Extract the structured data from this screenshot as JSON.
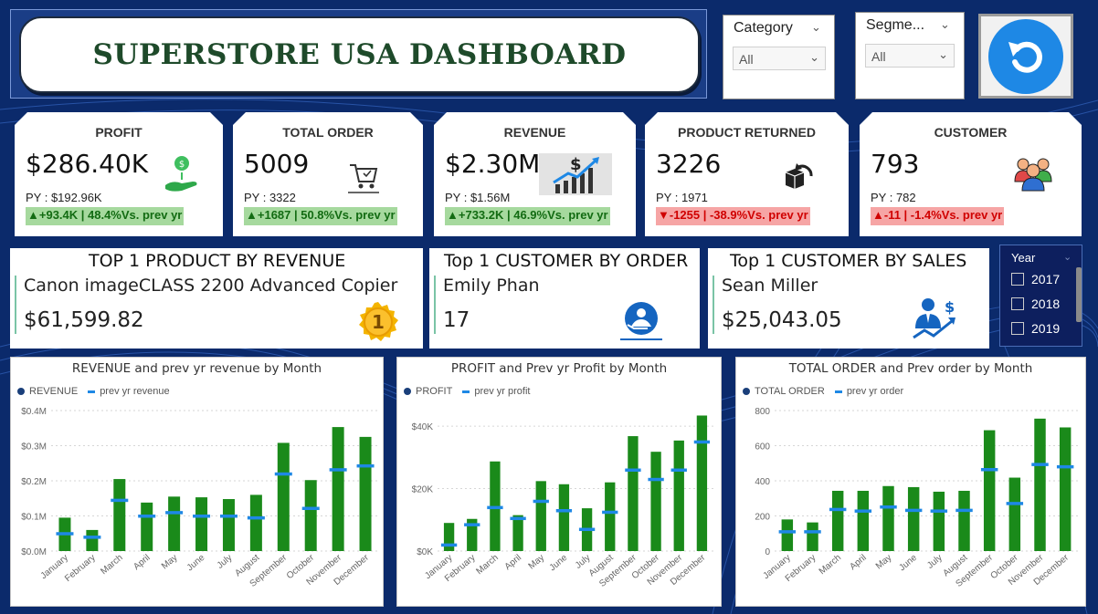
{
  "header": {
    "title": "SUPERSTORE USA DASHBOARD"
  },
  "filters": {
    "category": {
      "label": "Category",
      "value": "All"
    },
    "segment": {
      "label": "Segme...",
      "value": "All"
    },
    "reset_icon": "reset-arrow-icon"
  },
  "kpis": [
    {
      "title": "PROFIT",
      "value": "$286.40K",
      "py": "PY : $192.96K",
      "delta": "▲+93.4K | 48.4%Vs. prev yr",
      "trend": "up",
      "icon": "money-hand-icon"
    },
    {
      "title": "TOTAL ORDER",
      "value": "5009",
      "py": "PY :  3322",
      "delta": "▲+1687 | 50.8%Vs. prev yr",
      "trend": "up",
      "icon": "cart-icon"
    },
    {
      "title": "REVENUE",
      "value": "$2.30M",
      "py": "PY : $1.56M",
      "delta": "▲+733.2K | 46.9%Vs. prev yr",
      "trend": "up",
      "icon": "revenue-growth-icon"
    },
    {
      "title": "PRODUCT RETURNED",
      "value": "3226",
      "py": "PY :  1971",
      "delta": "▼-1255 | -38.9%Vs. prev yr",
      "trend": "down",
      "icon": "return-box-icon"
    },
    {
      "title": "CUSTOMER",
      "value": "793",
      "py": "PY : 782",
      "delta": "▲-11 | -1.4%Vs. prev yr",
      "trend": "down",
      "icon": "customers-icon"
    }
  ],
  "top_cards": [
    {
      "title": "TOP 1 PRODUCT BY REVENUE",
      "name": "Canon imageCLASS 2200 Advanced Copier",
      "value": "$61,599.82",
      "icon": "first-place-medal-icon"
    },
    {
      "title": "Top 1 CUSTOMER BY ORDER",
      "name": "Emily Phan",
      "value": "17",
      "icon": "customer-service-icon"
    },
    {
      "title": "Top 1 CUSTOMER BY SALES",
      "name": "Sean Miller",
      "value": "$25,043.05",
      "icon": "businessman-growth-icon"
    }
  ],
  "year_slicer": {
    "title": "Year",
    "options": [
      "2017",
      "2018",
      "2019"
    ]
  },
  "colors": {
    "bar": "#1a8a1a",
    "prev_marker": "#1e88e5",
    "legend_dot": "#1a3f7a",
    "background": "#0b2a6b"
  },
  "chart_data": [
    {
      "type": "bar",
      "title": "REVENUE and prev yr revenue by Month",
      "legend": [
        "REVENUE",
        "prev yr revenue"
      ],
      "categories": [
        "January",
        "February",
        "March",
        "April",
        "May",
        "June",
        "July",
        "August",
        "September",
        "October",
        "November",
        "December"
      ],
      "series": [
        {
          "name": "REVENUE",
          "values": [
            0.095,
            0.06,
            0.205,
            0.138,
            0.155,
            0.153,
            0.148,
            0.16,
            0.308,
            0.202,
            0.353,
            0.325
          ]
        },
        {
          "name": "prev yr revenue",
          "values": [
            0.05,
            0.04,
            0.145,
            0.1,
            0.11,
            0.1,
            0.1,
            0.095,
            0.22,
            0.122,
            0.232,
            0.243
          ]
        }
      ],
      "ylim": [
        0,
        0.4
      ],
      "yticks": [
        "$0.0M",
        "$0.1M",
        "$0.2M",
        "$0.3M",
        "$0.4M"
      ],
      "ytick_values": [
        0,
        0.1,
        0.2,
        0.3,
        0.4
      ],
      "grid": true
    },
    {
      "type": "bar",
      "title": "PROFIT and Prev yr Profit by Month",
      "legend": [
        "PROFIT",
        "prev yr profit"
      ],
      "categories": [
        "January",
        "February",
        "March",
        "April",
        "May",
        "June",
        "July",
        "August",
        "September",
        "October",
        "November",
        "December"
      ],
      "series": [
        {
          "name": "PROFIT",
          "values": [
            9000,
            10300,
            28700,
            11500,
            22400,
            21400,
            13700,
            22000,
            36800,
            31800,
            35400,
            43400
          ]
        },
        {
          "name": "prev yr profit",
          "values": [
            2000,
            8500,
            14000,
            10500,
            16000,
            13000,
            7000,
            12500,
            26000,
            23000,
            26000,
            35000
          ]
        }
      ],
      "ylim": [
        0,
        45000
      ],
      "yticks": [
        "$0K",
        "$20K",
        "$40K"
      ],
      "ytick_values": [
        0,
        20000,
        40000
      ],
      "grid": true
    },
    {
      "type": "bar",
      "title": "TOTAL ORDER and Prev order by Month",
      "legend": [
        "TOTAL ORDER",
        "prev yr order"
      ],
      "categories": [
        "January",
        "February",
        "March",
        "April",
        "May",
        "June",
        "July",
        "August",
        "September",
        "October",
        "November",
        "December"
      ],
      "series": [
        {
          "name": "TOTAL ORDER",
          "values": [
            180,
            163,
            343,
            343,
            370,
            364,
            338,
            343,
            688,
            418,
            754,
            704
          ]
        },
        {
          "name": "prev yr order",
          "values": [
            111,
            111,
            238,
            229,
            252,
            233,
            229,
            233,
            465,
            272,
            494,
            481
          ]
        }
      ],
      "ylim": [
        0,
        800
      ],
      "yticks": [
        "0",
        "200",
        "400",
        "600",
        "800"
      ],
      "ytick_values": [
        0,
        200,
        400,
        600,
        800
      ],
      "grid": true
    }
  ]
}
